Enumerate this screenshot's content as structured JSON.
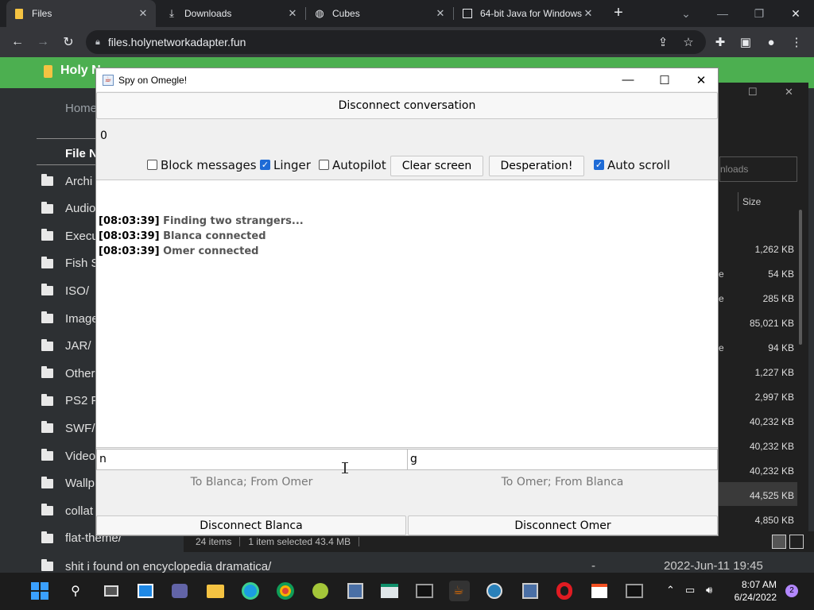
{
  "browser": {
    "tabs": [
      {
        "label": "Files",
        "icon": "folder-icon"
      },
      {
        "label": "Downloads",
        "icon": "download-icon"
      },
      {
        "label": "Cubes",
        "icon": "globe-icon"
      },
      {
        "label": "64-bit Java for Windows",
        "icon": "page-icon"
      }
    ],
    "url": "files.holynetworkadapter.fun"
  },
  "site": {
    "title": "Holy N",
    "breadcrumb": "Home",
    "column_header": "File N",
    "folders": [
      "Archi",
      "Audio",
      "Execu",
      "Fish S",
      "ISO/",
      "Image",
      "JAR/",
      "Other",
      "PS2 F",
      "SWF/",
      "Video",
      "Wallp",
      "collat",
      "flat-theme/"
    ],
    "last_row": {
      "name": "shit i found on encyclopedia dramatica/",
      "size": "-",
      "date": "2022-Jun-11 19:45"
    }
  },
  "explorer": {
    "search_placeholder": "nloads",
    "size_header": "Size",
    "sizes": [
      "1,262 KB",
      "54 KB",
      "285 KB",
      "85,021 KB",
      "94 KB",
      "1,227 KB",
      "2,997 KB",
      "40,232 KB",
      "40,232 KB",
      "40,232 KB",
      "44,525 KB",
      "4,850 KB"
    ],
    "status_items": "24 items",
    "status_selected": "1 item selected  43.4 MB"
  },
  "app": {
    "title": "Spy on Omegle!",
    "disconnect_conversation": "Disconnect conversation",
    "counter": "0",
    "options": {
      "block_messages": {
        "label": "Block messages",
        "checked": false
      },
      "linger": {
        "label": "Linger",
        "checked": true
      },
      "autopilot": {
        "label": "Autopilot",
        "checked": false
      },
      "clear_screen": "Clear screen",
      "desperation": "Desperation!",
      "auto_scroll": {
        "label": "Auto scroll",
        "checked": true
      }
    },
    "log": [
      {
        "time": "[08:03:39]",
        "msg": "Finding two strangers..."
      },
      {
        "time": "[08:03:39]",
        "msg": "Blanca connected"
      },
      {
        "time": "[08:03:39]",
        "msg": "Omer connected"
      }
    ],
    "input_left": "n",
    "input_right": "g",
    "label_left": "To Blanca; From Omer",
    "label_right": "To Omer; From Blanca",
    "disconnect_left": "Disconnect Blanca",
    "disconnect_right": "Disconnect Omer"
  },
  "taskbar": {
    "time": "8:07 AM",
    "date": "6/24/2022",
    "notifications": "2"
  }
}
